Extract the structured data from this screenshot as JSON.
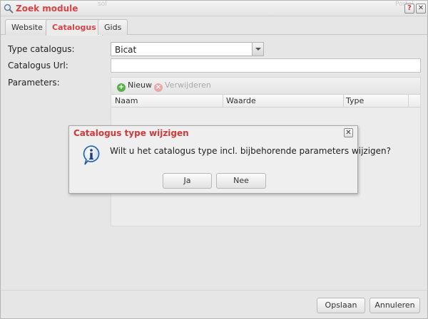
{
  "window": {
    "title": "Zoek module",
    "ghost_text_left": "sol",
    "ghost_text_right": "Portal",
    "help_glyph": "?",
    "close_glyph": "✕"
  },
  "tabs": [
    {
      "label": "Website",
      "active": false
    },
    {
      "label": "Catalogus",
      "active": true
    },
    {
      "label": "Gids",
      "active": false
    }
  ],
  "form": {
    "type_label": "Type catalogus:",
    "type_value": "Bicat",
    "url_label": "Catalogus Url:",
    "url_value": "",
    "params_label": "Parameters:"
  },
  "grid": {
    "toolbar": {
      "new_label": "Nieuw",
      "delete_label": "Verwijderen"
    },
    "columns": [
      "Naam",
      "Waarde",
      "Type"
    ],
    "rows": []
  },
  "footer": {
    "save_label": "Opslaan",
    "cancel_label": "Annuleren"
  },
  "dialog": {
    "title": "Catalogus type wijzigen",
    "message": "Wilt u het catalogus type incl. bijbehorende parameters wijzigen?",
    "yes_label": "Ja",
    "no_label": "Nee",
    "icon": "info-icon"
  },
  "colors": {
    "title_red": "#d64545",
    "dialog_title_red": "#d23a3a",
    "info_blue": "#1f5fae",
    "new_green": "#58b04a"
  }
}
